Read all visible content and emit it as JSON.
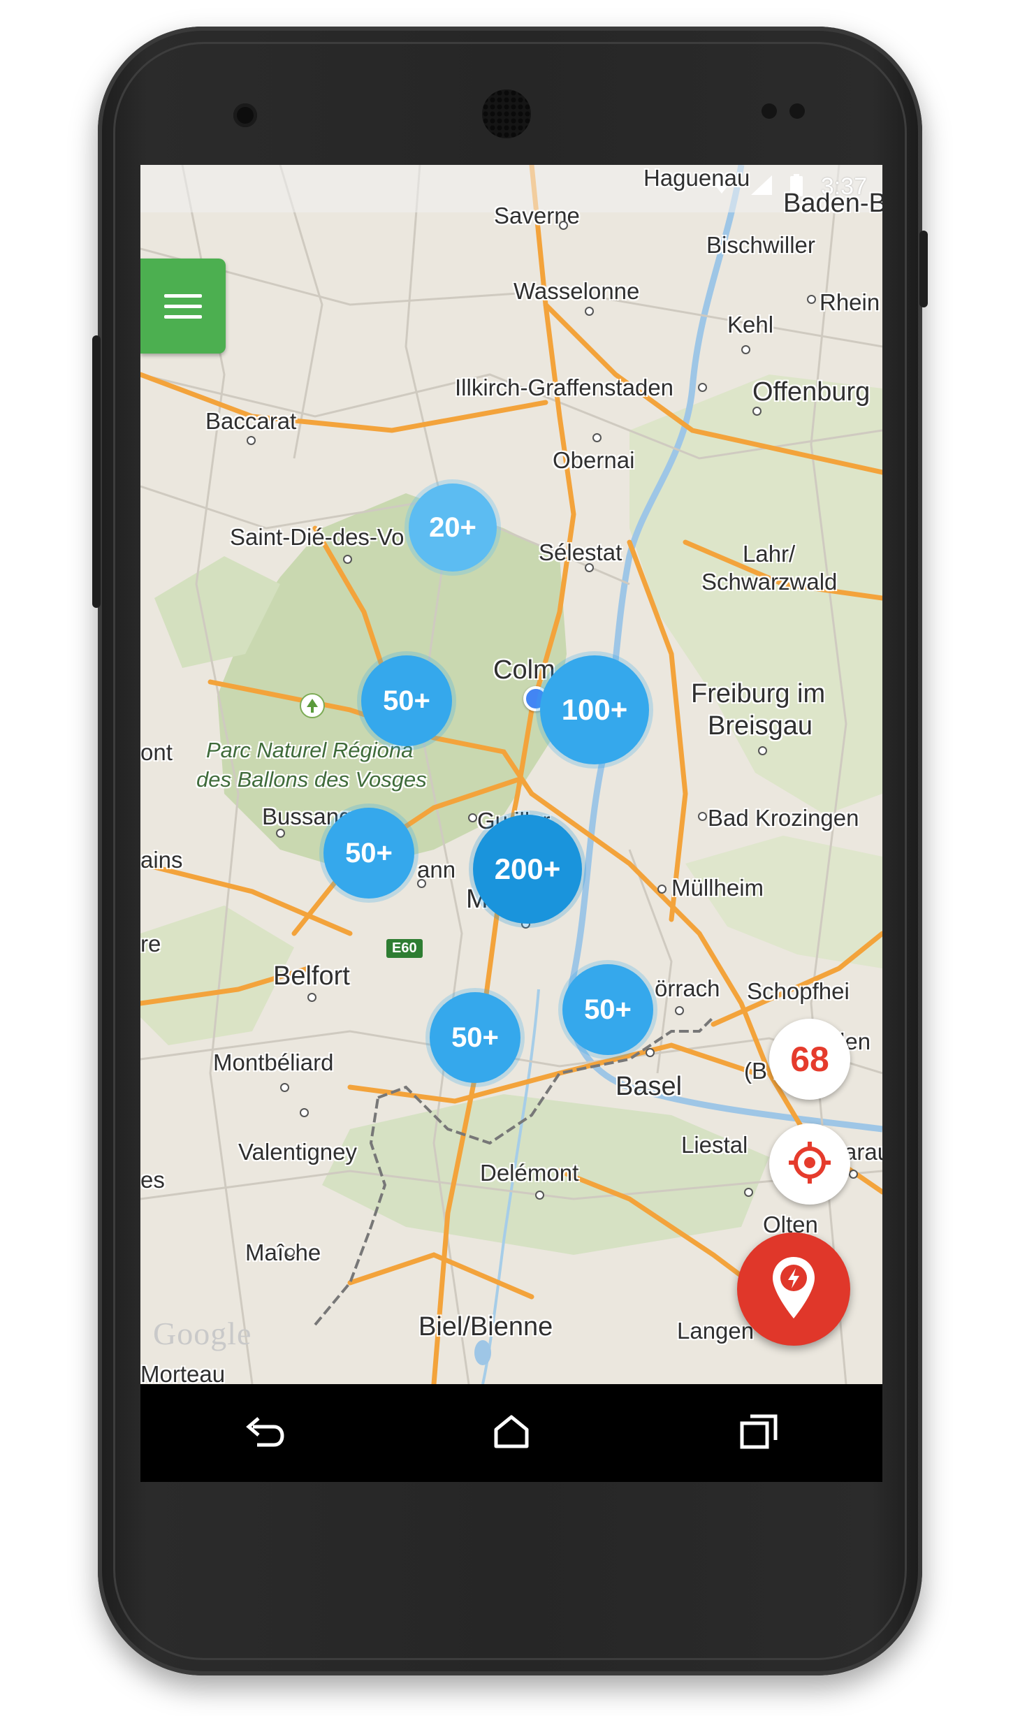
{
  "status_bar": {
    "time": "3:37"
  },
  "map": {
    "labels": {
      "haguenau": "Haguenau",
      "baden": "Baden-B",
      "saverne": "Saverne",
      "bischwiller": "Bischwiller",
      "wasselonne": "Wasselonne",
      "rhein": "Rhein",
      "kehl": "Kehl",
      "illkirch": "Illkirch-Graffenstaden",
      "offenburg": "Offenburg",
      "baccarat": "Baccarat",
      "obernai": "Obernai",
      "saint_die": "Saint-Dié-des-Vo",
      "selestat": "Sélestat",
      "lahr": "Lahr/",
      "schwarzwald": "Schwarzwald",
      "colmar": "Colm",
      "freiburg1": "Freiburg im",
      "freiburg2": "Breisgau",
      "ont": "ont",
      "park1": "Parc Naturel Régiona",
      "park2": "des Ballons des Vosges",
      "bussang": "Bussang",
      "guebwiller": "Gu    iller",
      "bad_krozingen": "Bad Krozingen",
      "ains": "ains",
      "ann": "ann",
      "mulhouse": "M         se",
      "mullheim": "Müllheim",
      "re": "re",
      "e60": "E60",
      "belfort": "Belfort",
      "lorrach": "örrach",
      "schopfheim": "Schopfhei",
      "den": "den",
      "baden_paren": "(B     n)",
      "montbeliard": "Montbéliard",
      "basel": "Basel",
      "liestal": "Liestal",
      "aarau": "Aarau",
      "valentigney": "Valentigney",
      "es": "es",
      "delemont": "Delémont",
      "olten": "Olten",
      "maiche": "Maîche",
      "biel": "Biel/Bienne",
      "langen": "Langen",
      "morteau": "Morteau"
    },
    "google_logo": "Google",
    "clusters": {
      "c20": "20+",
      "c50a": "50+",
      "c100": "100+",
      "c50b": "50+",
      "c200": "200+",
      "c50c": "50+",
      "c50d": "50+"
    }
  },
  "actions": {
    "station_count": "68"
  },
  "colors": {
    "menu_green": "#4caf50",
    "cluster_blue": "#35a8ec",
    "charge_red": "#e0372a",
    "count_red": "#e53b2c"
  },
  "icons": {
    "menu": "hamburger-icon",
    "locate": "crosshair-icon",
    "charge": "charging-pin-icon",
    "back": "back-icon",
    "home": "home-icon",
    "recents": "recents-icon"
  }
}
